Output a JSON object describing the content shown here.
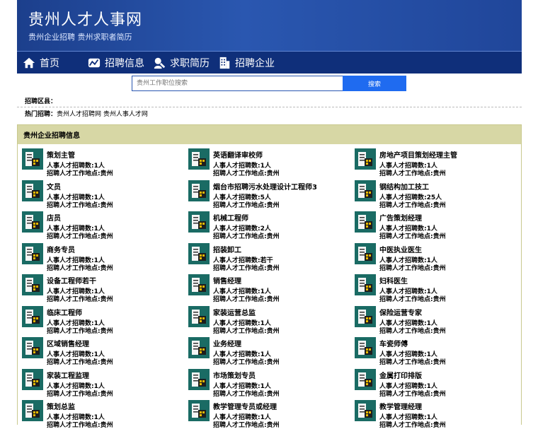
{
  "header": {
    "title": "贵州人才人事网",
    "subtitle": "贵州企业招聘 贵州求职者简历"
  },
  "nav": [
    {
      "label": "首页",
      "icon": "home-icon"
    },
    {
      "label": "招聘信息",
      "icon": "chart-icon"
    },
    {
      "label": "求职简历",
      "icon": "person-icon"
    },
    {
      "label": "招聘企业",
      "icon": "building-icon"
    }
  ],
  "search": {
    "placeholder": "贵州工作职位搜索",
    "button": "搜索"
  },
  "area": {
    "label": "招聘区县："
  },
  "hot": {
    "label": "热门招聘：",
    "links": [
      "贵州人才招聘网",
      "贵州人事人才网"
    ]
  },
  "panel": {
    "title": "贵州企业招聘信息"
  },
  "jobs": [
    {
      "title": "策划主管",
      "count": "人事人才招聘数:1人",
      "place": "招聘人才工作地点:贵州"
    },
    {
      "title": "英语翻译审校师",
      "count": "人事人才招聘数:1人",
      "place": "招聘人才工作地点:贵州"
    },
    {
      "title": "房地产项目策划经理主管",
      "count": "人事人才招聘数:1人",
      "place": "招聘人才工作地点:贵州"
    },
    {
      "title": "文员",
      "count": "人事人才招聘数:1人",
      "place": "招聘人才工作地点:贵州"
    },
    {
      "title": "烟台市招聘污水处理设计工程师3",
      "count": "人事人才招聘数:5人",
      "place": "招聘人才工作地点:贵州"
    },
    {
      "title": "钢结构加工技工",
      "count": "人事人才招聘数:25人",
      "place": "招聘人才工作地点:贵州"
    },
    {
      "title": "店员",
      "count": "人事人才招聘数:1人",
      "place": "招聘人才工作地点:贵州"
    },
    {
      "title": "机械工程师",
      "count": "人事人才招聘数:2人",
      "place": "招聘人才工作地点:贵州"
    },
    {
      "title": "广告策划经理",
      "count": "人事人才招聘数:1人",
      "place": "招聘人才工作地点:贵州"
    },
    {
      "title": "商务专员",
      "count": "人事人才招聘数:1人",
      "place": "招聘人才工作地点:贵州"
    },
    {
      "title": "招装卸工",
      "count": "人事人才招聘数:若干",
      "place": "招聘人才工作地点:贵州"
    },
    {
      "title": "中医执业医生",
      "count": "人事人才招聘数:1人",
      "place": "招聘人才工作地点:贵州"
    },
    {
      "title": "设备工程师若干",
      "count": "人事人才招聘数:1人",
      "place": "招聘人才工作地点:贵州"
    },
    {
      "title": "销售经理",
      "count": "人事人才招聘数:1人",
      "place": "招聘人才工作地点:贵州"
    },
    {
      "title": "妇科医生",
      "count": "人事人才招聘数:1人",
      "place": "招聘人才工作地点:贵州"
    },
    {
      "title": "临床工程师",
      "count": "人事人才招聘数:1人",
      "place": "招聘人才工作地点:贵州"
    },
    {
      "title": "家装运营总监",
      "count": "人事人才招聘数:1人",
      "place": "招聘人才工作地点:贵州"
    },
    {
      "title": "保险运营专家",
      "count": "人事人才招聘数:1人",
      "place": "招聘人才工作地点:贵州"
    },
    {
      "title": "区域销售经理",
      "count": "人事人才招聘数:1人",
      "place": "招聘人才工作地点:贵州"
    },
    {
      "title": "业务经理",
      "count": "人事人才招聘数:1人",
      "place": "招聘人才工作地点:贵州"
    },
    {
      "title": "车瓷师傅",
      "count": "人事人才招聘数:1人",
      "place": "招聘人才工作地点:贵州"
    },
    {
      "title": "家装工程监理",
      "count": "人事人才招聘数:1人",
      "place": "招聘人才工作地点:贵州"
    },
    {
      "title": "市场策划专员",
      "count": "人事人才招聘数:1人",
      "place": "招聘人才工作地点:贵州"
    },
    {
      "title": "金属打印排版",
      "count": "人事人才招聘数:1人",
      "place": "招聘人才工作地点:贵州"
    },
    {
      "title": "策划总监",
      "count": "人事人才招聘数:1人",
      "place": "招聘人才工作地点:贵州"
    },
    {
      "title": "教学管理专员或经理",
      "count": "人事人才招聘数:1人",
      "place": "招聘人才工作地点:贵州"
    },
    {
      "title": "教学管理经理",
      "count": "人事人才招聘数:1人",
      "place": "招聘人才工作地点:贵州"
    }
  ]
}
